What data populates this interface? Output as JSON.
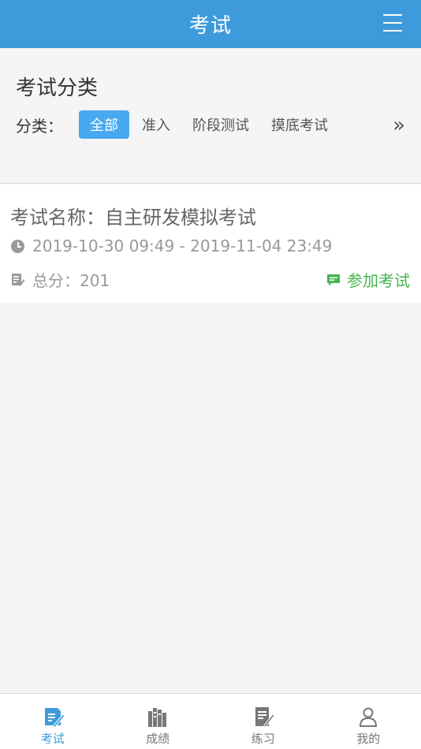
{
  "header": {
    "title": "考试"
  },
  "category": {
    "section_title": "考试分类",
    "label": "分类：",
    "items": [
      {
        "label": "全部",
        "active": true
      },
      {
        "label": "准入",
        "active": false
      },
      {
        "label": "阶段测试",
        "active": false
      },
      {
        "label": "摸底考试",
        "active": false
      }
    ],
    "more_glyph": "»"
  },
  "exam": {
    "name": "考试名称：自主研发模拟考试",
    "time_range": "2019-10-30 09:49 - 2019-11-04 23:49",
    "score": "总分：201",
    "join_label": "参加考试"
  },
  "tabbar": {
    "items": [
      {
        "label": "考试",
        "icon": "exam-icon",
        "active": true
      },
      {
        "label": "成绩",
        "icon": "score-icon",
        "active": false
      },
      {
        "label": "练习",
        "icon": "practice-icon",
        "active": false
      },
      {
        "label": "我的",
        "icon": "profile-icon",
        "active": false
      }
    ]
  },
  "colors": {
    "primary": "#3d9bdc",
    "active_tag": "#47a9f0",
    "join": "#45b54f"
  }
}
